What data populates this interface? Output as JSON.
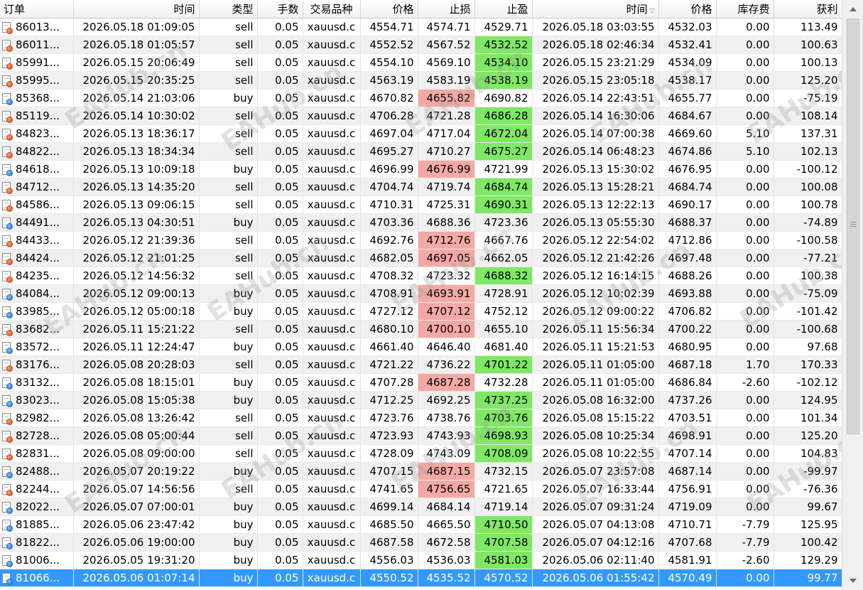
{
  "columns": [
    {
      "key": "order",
      "label": "订单",
      "width": 103,
      "align": "left"
    },
    {
      "key": "open_time",
      "label": "时间",
      "width": 177,
      "align": "right"
    },
    {
      "key": "type",
      "label": "类型",
      "width": 82,
      "align": "right"
    },
    {
      "key": "lots",
      "label": "手数",
      "width": 64,
      "align": "right"
    },
    {
      "key": "symbol",
      "label": "交易品种",
      "width": 81,
      "align": "center"
    },
    {
      "key": "open_price",
      "label": "价格",
      "width": 81,
      "align": "right"
    },
    {
      "key": "sl",
      "label": "止损",
      "width": 80,
      "align": "right"
    },
    {
      "key": "tp",
      "label": "止盈",
      "width": 81,
      "align": "right"
    },
    {
      "key": "close_time",
      "label": "时间",
      "width": 178,
      "align": "right",
      "sorted": true
    },
    {
      "key": "close_price",
      "label": "价格",
      "width": 81,
      "align": "right"
    },
    {
      "key": "swap",
      "label": "库存费",
      "width": 81,
      "align": "right"
    },
    {
      "key": "profit",
      "label": "获利",
      "width": 96,
      "align": "right"
    }
  ],
  "highlight_colors": {
    "tp_hit": "#7fe864",
    "sl_hit": "#f6a9a4",
    "selected": "#3399ff"
  },
  "rows": [
    {
      "order": "86013...",
      "open_time": "2026.05.18 01:09:05",
      "type": "sell",
      "lots": "0.05",
      "symbol": "xauusd.c",
      "open_price": "4554.71",
      "sl": "4574.71",
      "tp": "4529.71",
      "close_time": "2026.05.18 03:03:55",
      "close_price": "4532.03",
      "swap": "0.00",
      "profit": "113.49",
      "hit": ""
    },
    {
      "order": "86011...",
      "open_time": "2026.05.18 01:05:57",
      "type": "sell",
      "lots": "0.05",
      "symbol": "xauusd.c",
      "open_price": "4552.52",
      "sl": "4567.52",
      "tp": "4532.52",
      "close_time": "2026.05.18 02:46:34",
      "close_price": "4532.41",
      "swap": "0.00",
      "profit": "100.63",
      "hit": "tp"
    },
    {
      "order": "85991...",
      "open_time": "2026.05.15 20:06:49",
      "type": "sell",
      "lots": "0.05",
      "symbol": "xauusd.c",
      "open_price": "4554.10",
      "sl": "4569.10",
      "tp": "4534.10",
      "close_time": "2026.05.15 23:21:29",
      "close_price": "4534.09",
      "swap": "0.00",
      "profit": "100.13",
      "hit": "tp"
    },
    {
      "order": "85995...",
      "open_time": "2026.05.15 20:35:25",
      "type": "sell",
      "lots": "0.05",
      "symbol": "xauusd.c",
      "open_price": "4563.19",
      "sl": "4583.19",
      "tp": "4538.19",
      "close_time": "2026.05.15 23:05:18",
      "close_price": "4538.17",
      "swap": "0.00",
      "profit": "125.20",
      "hit": "tp"
    },
    {
      "order": "85368...",
      "open_time": "2026.05.14 21:03:06",
      "type": "buy",
      "lots": "0.05",
      "symbol": "xauusd.c",
      "open_price": "4670.82",
      "sl": "4655.82",
      "tp": "4690.82",
      "close_time": "2026.05.14 22:43:51",
      "close_price": "4655.77",
      "swap": "0.00",
      "profit": "-75.19",
      "hit": "sl"
    },
    {
      "order": "85119...",
      "open_time": "2026.05.14 10:30:02",
      "type": "sell",
      "lots": "0.05",
      "symbol": "xauusd.c",
      "open_price": "4706.28",
      "sl": "4721.28",
      "tp": "4686.28",
      "close_time": "2026.05.14 16:30:06",
      "close_price": "4684.67",
      "swap": "0.00",
      "profit": "108.14",
      "hit": "tp"
    },
    {
      "order": "84823...",
      "open_time": "2026.05.13 18:36:17",
      "type": "sell",
      "lots": "0.05",
      "symbol": "xauusd.c",
      "open_price": "4697.04",
      "sl": "4717.04",
      "tp": "4672.04",
      "close_time": "2026.05.14 07:00:38",
      "close_price": "4669.60",
      "swap": "5.10",
      "profit": "137.31",
      "hit": "tp"
    },
    {
      "order": "84822...",
      "open_time": "2026.05.13 18:34:34",
      "type": "sell",
      "lots": "0.05",
      "symbol": "xauusd.c",
      "open_price": "4695.27",
      "sl": "4710.27",
      "tp": "4675.27",
      "close_time": "2026.05.14 06:48:23",
      "close_price": "4674.86",
      "swap": "5.10",
      "profit": "102.13",
      "hit": "tp"
    },
    {
      "order": "84618...",
      "open_time": "2026.05.13 10:09:18",
      "type": "buy",
      "lots": "0.05",
      "symbol": "xauusd.c",
      "open_price": "4696.99",
      "sl": "4676.99",
      "tp": "4721.99",
      "close_time": "2026.05.13 15:30:02",
      "close_price": "4676.95",
      "swap": "0.00",
      "profit": "-100.12",
      "hit": "sl"
    },
    {
      "order": "84712...",
      "open_time": "2026.05.13 14:35:20",
      "type": "sell",
      "lots": "0.05",
      "symbol": "xauusd.c",
      "open_price": "4704.74",
      "sl": "4719.74",
      "tp": "4684.74",
      "close_time": "2026.05.13 15:28:21",
      "close_price": "4684.74",
      "swap": "0.00",
      "profit": "100.08",
      "hit": "tp"
    },
    {
      "order": "84586...",
      "open_time": "2026.05.13 09:06:15",
      "type": "sell",
      "lots": "0.05",
      "symbol": "xauusd.c",
      "open_price": "4710.31",
      "sl": "4725.31",
      "tp": "4690.31",
      "close_time": "2026.05.13 12:22:13",
      "close_price": "4690.17",
      "swap": "0.00",
      "profit": "100.78",
      "hit": "tp"
    },
    {
      "order": "84491...",
      "open_time": "2026.05.13 04:30:51",
      "type": "buy",
      "lots": "0.05",
      "symbol": "xauusd.c",
      "open_price": "4703.36",
      "sl": "4688.36",
      "tp": "4723.36",
      "close_time": "2026.05.13 05:55:30",
      "close_price": "4688.37",
      "swap": "0.00",
      "profit": "-74.89",
      "hit": ""
    },
    {
      "order": "84433...",
      "open_time": "2026.05.12 21:39:36",
      "type": "sell",
      "lots": "0.05",
      "symbol": "xauusd.c",
      "open_price": "4692.76",
      "sl": "4712.76",
      "tp": "4667.76",
      "close_time": "2026.05.12 22:54:02",
      "close_price": "4712.86",
      "swap": "0.00",
      "profit": "-100.58",
      "hit": "sl"
    },
    {
      "order": "84424...",
      "open_time": "2026.05.12 21:01:25",
      "type": "sell",
      "lots": "0.05",
      "symbol": "xauusd.c",
      "open_price": "4682.05",
      "sl": "4697.05",
      "tp": "4662.05",
      "close_time": "2026.05.12 21:42:26",
      "close_price": "4697.48",
      "swap": "0.00",
      "profit": "-77.21",
      "hit": "sl"
    },
    {
      "order": "84235...",
      "open_time": "2026.05.12 14:56:32",
      "type": "sell",
      "lots": "0.05",
      "symbol": "xauusd.c",
      "open_price": "4708.32",
      "sl": "4723.32",
      "tp": "4688.32",
      "close_time": "2026.05.12 16:14:15",
      "close_price": "4688.26",
      "swap": "0.00",
      "profit": "100.38",
      "hit": "tp"
    },
    {
      "order": "84084...",
      "open_time": "2026.05.12 09:00:13",
      "type": "buy",
      "lots": "0.05",
      "symbol": "xauusd.c",
      "open_price": "4708.91",
      "sl": "4693.91",
      "tp": "4728.91",
      "close_time": "2026.05.12 10:02:39",
      "close_price": "4693.88",
      "swap": "0.00",
      "profit": "-75.09",
      "hit": "sl"
    },
    {
      "order": "83985...",
      "open_time": "2026.05.12 05:00:18",
      "type": "buy",
      "lots": "0.05",
      "symbol": "xauusd.c",
      "open_price": "4727.12",
      "sl": "4707.12",
      "tp": "4752.12",
      "close_time": "2026.05.12 09:00:22",
      "close_price": "4706.82",
      "swap": "0.00",
      "profit": "-101.42",
      "hit": "sl"
    },
    {
      "order": "83682...",
      "open_time": "2026.05.11 15:21:22",
      "type": "sell",
      "lots": "0.05",
      "symbol": "xauusd.c",
      "open_price": "4680.10",
      "sl": "4700.10",
      "tp": "4655.10",
      "close_time": "2026.05.11 15:56:34",
      "close_price": "4700.22",
      "swap": "0.00",
      "profit": "-100.68",
      "hit": "sl"
    },
    {
      "order": "83572...",
      "open_time": "2026.05.11 12:24:47",
      "type": "buy",
      "lots": "0.05",
      "symbol": "xauusd.c",
      "open_price": "4661.40",
      "sl": "4646.40",
      "tp": "4681.40",
      "close_time": "2026.05.11 15:21:53",
      "close_price": "4680.95",
      "swap": "0.00",
      "profit": "97.68",
      "hit": ""
    },
    {
      "order": "83176...",
      "open_time": "2026.05.08 20:28:03",
      "type": "sell",
      "lots": "0.05",
      "symbol": "xauusd.c",
      "open_price": "4721.22",
      "sl": "4736.22",
      "tp": "4701.22",
      "close_time": "2026.05.11 01:05:00",
      "close_price": "4687.18",
      "swap": "1.70",
      "profit": "170.33",
      "hit": "tp"
    },
    {
      "order": "83132...",
      "open_time": "2026.05.08 18:15:01",
      "type": "buy",
      "lots": "0.05",
      "symbol": "xauusd.c",
      "open_price": "4707.28",
      "sl": "4687.28",
      "tp": "4732.28",
      "close_time": "2026.05.11 01:05:00",
      "close_price": "4686.84",
      "swap": "-2.60",
      "profit": "-102.12",
      "hit": "sl"
    },
    {
      "order": "83023...",
      "open_time": "2026.05.08 15:05:38",
      "type": "buy",
      "lots": "0.05",
      "symbol": "xauusd.c",
      "open_price": "4712.25",
      "sl": "4692.25",
      "tp": "4737.25",
      "close_time": "2026.05.08 16:32:00",
      "close_price": "4737.26",
      "swap": "0.00",
      "profit": "124.95",
      "hit": "tp"
    },
    {
      "order": "82982...",
      "open_time": "2026.05.08 13:26:42",
      "type": "sell",
      "lots": "0.05",
      "symbol": "xauusd.c",
      "open_price": "4723.76",
      "sl": "4738.76",
      "tp": "4703.76",
      "close_time": "2026.05.08 15:15:22",
      "close_price": "4703.51",
      "swap": "0.00",
      "profit": "101.34",
      "hit": "tp"
    },
    {
      "order": "82728...",
      "open_time": "2026.05.08 05:00:44",
      "type": "sell",
      "lots": "0.05",
      "symbol": "xauusd.c",
      "open_price": "4723.93",
      "sl": "4743.93",
      "tp": "4698.93",
      "close_time": "2026.05.08 10:25:34",
      "close_price": "4698.91",
      "swap": "0.00",
      "profit": "125.20",
      "hit": "tp"
    },
    {
      "order": "82831...",
      "open_time": "2026.05.08 09:00:00",
      "type": "sell",
      "lots": "0.05",
      "symbol": "xauusd.c",
      "open_price": "4728.09",
      "sl": "4743.09",
      "tp": "4708.09",
      "close_time": "2026.05.08 10:22:55",
      "close_price": "4707.14",
      "swap": "0.00",
      "profit": "104.83",
      "hit": "tp"
    },
    {
      "order": "82488...",
      "open_time": "2026.05.07 20:19:22",
      "type": "buy",
      "lots": "0.05",
      "symbol": "xauusd.c",
      "open_price": "4707.15",
      "sl": "4687.15",
      "tp": "4732.15",
      "close_time": "2026.05.07 23:57:08",
      "close_price": "4687.14",
      "swap": "0.00",
      "profit": "-99.97",
      "hit": "sl"
    },
    {
      "order": "82244...",
      "open_time": "2026.05.07 14:56:56",
      "type": "sell",
      "lots": "0.05",
      "symbol": "xauusd.c",
      "open_price": "4741.65",
      "sl": "4756.65",
      "tp": "4721.65",
      "close_time": "2026.05.07 16:33:44",
      "close_price": "4756.91",
      "swap": "0.00",
      "profit": "-76.36",
      "hit": "sl"
    },
    {
      "order": "82022...",
      "open_time": "2026.05.07 07:00:01",
      "type": "buy",
      "lots": "0.05",
      "symbol": "xauusd.c",
      "open_price": "4699.14",
      "sl": "4684.14",
      "tp": "4719.14",
      "close_time": "2026.05.07 09:31:24",
      "close_price": "4719.09",
      "swap": "0.00",
      "profit": "99.67",
      "hit": ""
    },
    {
      "order": "81885...",
      "open_time": "2026.05.06 23:47:42",
      "type": "buy",
      "lots": "0.05",
      "symbol": "xauusd.c",
      "open_price": "4685.50",
      "sl": "4665.50",
      "tp": "4710.50",
      "close_time": "2026.05.07 04:13:08",
      "close_price": "4710.71",
      "swap": "-7.79",
      "profit": "125.95",
      "hit": "tp"
    },
    {
      "order": "81822...",
      "open_time": "2026.05.06 19:00:00",
      "type": "buy",
      "lots": "0.05",
      "symbol": "xauusd.c",
      "open_price": "4687.58",
      "sl": "4672.58",
      "tp": "4707.58",
      "close_time": "2026.05.07 04:12:16",
      "close_price": "4707.68",
      "swap": "-7.79",
      "profit": "100.42",
      "hit": "tp"
    },
    {
      "order": "81006...",
      "open_time": "2026.05.05 19:31:20",
      "type": "buy",
      "lots": "0.05",
      "symbol": "xauusd.c",
      "open_price": "4556.03",
      "sl": "4536.03",
      "tp": "4581.03",
      "close_time": "2026.05.06 02:11:40",
      "close_price": "4581.91",
      "swap": "-2.60",
      "profit": "129.29",
      "hit": "tp"
    },
    {
      "order": "81066...",
      "open_time": "2026.05.06 01:07:14",
      "type": "buy",
      "lots": "0.05",
      "symbol": "xauusd.c",
      "open_price": "4550.52",
      "sl": "4535.52",
      "tp": "4570.52",
      "close_time": "2026.05.06 01:55:42",
      "close_price": "4570.49",
      "swap": "0.00",
      "profit": "99.77",
      "hit": "",
      "selected": true
    }
  ],
  "watermark_text": "EAHub.cn",
  "scrollbar": {
    "position": 0,
    "visible_fraction": 0.72
  }
}
